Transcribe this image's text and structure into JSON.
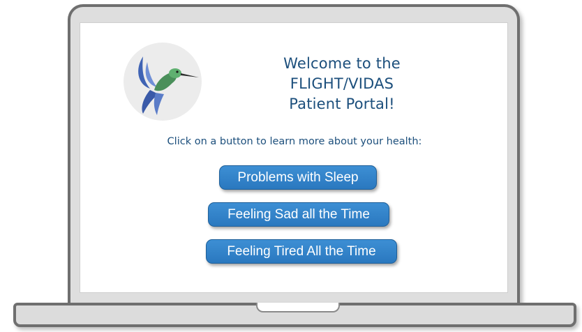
{
  "header": {
    "title_lines": [
      "Welcome to the",
      "FLIGHT/VIDAS",
      "Patient Portal!"
    ],
    "logo_icon": "hummingbird-logo-icon"
  },
  "instruction": "Click on a button to learn more about your health:",
  "buttons": [
    {
      "label": "Problems with Sleep"
    },
    {
      "label": "Feeling Sad all the Time"
    },
    {
      "label": "Feeling Tired All the Time"
    }
  ],
  "colors": {
    "title_text": "#1c4f7c",
    "button_bg": "#3183c8",
    "button_text": "#ffffff",
    "laptop_frame": "#6f6f6f",
    "laptop_body": "#dedede"
  }
}
